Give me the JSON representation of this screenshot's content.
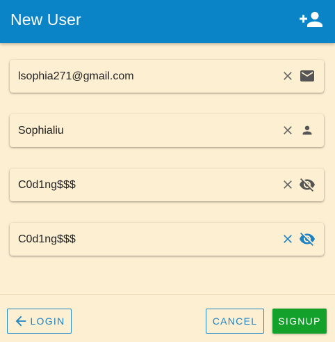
{
  "header": {
    "title": "New User",
    "action_icon": "person-add-icon"
  },
  "form": {
    "fields": [
      {
        "value": "lsophia271@gmail.com",
        "clear_icon": "close-icon",
        "trailing_icon": "email-icon"
      },
      {
        "value": "Sophialiu",
        "clear_icon": "close-icon",
        "trailing_icon": "person-icon"
      },
      {
        "value": "C0d1ng$$$",
        "clear_icon": "close-icon",
        "trailing_icon": "visibility-off-icon"
      },
      {
        "value": "C0d1ng$$$",
        "clear_icon": "close-icon",
        "trailing_icon": "visibility-off-icon",
        "focused": true
      }
    ]
  },
  "footer": {
    "login_label": "LOGIN",
    "login_icon": "arrow-left-icon",
    "cancel_label": "CANCEL",
    "signup_label": "SIGNUP"
  },
  "colors": {
    "header_bg": "#0a84c6",
    "page_bg": "#fdefd1",
    "accent": "#1f82c4",
    "signup_bg": "#14a12b",
    "icon_grey": "#666666"
  }
}
